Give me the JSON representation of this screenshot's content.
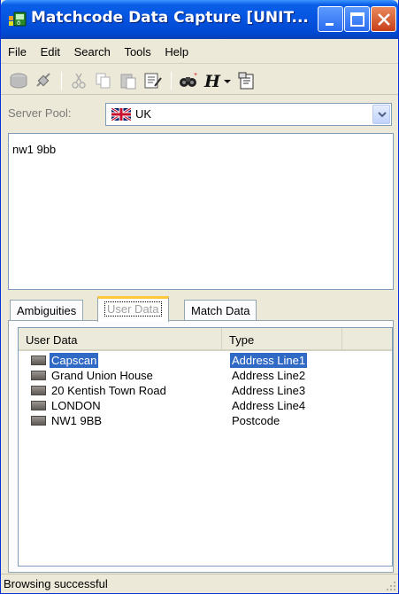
{
  "window": {
    "title": "Matchcode Data Capture [UNIT..."
  },
  "menu": [
    {
      "label": "File"
    },
    {
      "label": "Edit"
    },
    {
      "label": "Search"
    },
    {
      "label": "Tools"
    },
    {
      "label": "Help"
    }
  ],
  "toolbar": {
    "icons": [
      "database-icon",
      "connect-icon",
      "cut-icon",
      "copy-icon",
      "paste-icon",
      "edit-document-icon",
      "find-icon",
      "history-icon",
      "dropdown-arrow-icon",
      "properties-icon"
    ]
  },
  "server_pool": {
    "label": "Server Pool:",
    "value": "UK",
    "flag": "uk-flag-icon"
  },
  "input": {
    "text": "nw1 9bb"
  },
  "tabs": [
    {
      "label": "Ambiguities"
    },
    {
      "label": "User Data",
      "active": true
    },
    {
      "label": "Match Data"
    }
  ],
  "list": {
    "columns": [
      "User Data",
      "Type"
    ],
    "rows": [
      {
        "data": "Capscan",
        "type": "Address Line1",
        "selected": true
      },
      {
        "data": "Grand Union House",
        "type": "Address Line2"
      },
      {
        "data": "20 Kentish Town Road",
        "type": "Address Line3"
      },
      {
        "data": "LONDON",
        "type": "Address Line4"
      },
      {
        "data": "NW1 9BB",
        "type": "Postcode"
      }
    ]
  },
  "status": {
    "text": "Browsing successful"
  },
  "colors": {
    "titlebar": "#0553e0",
    "selection": "#316ac5",
    "tab_highlight": "#ffc83c"
  }
}
